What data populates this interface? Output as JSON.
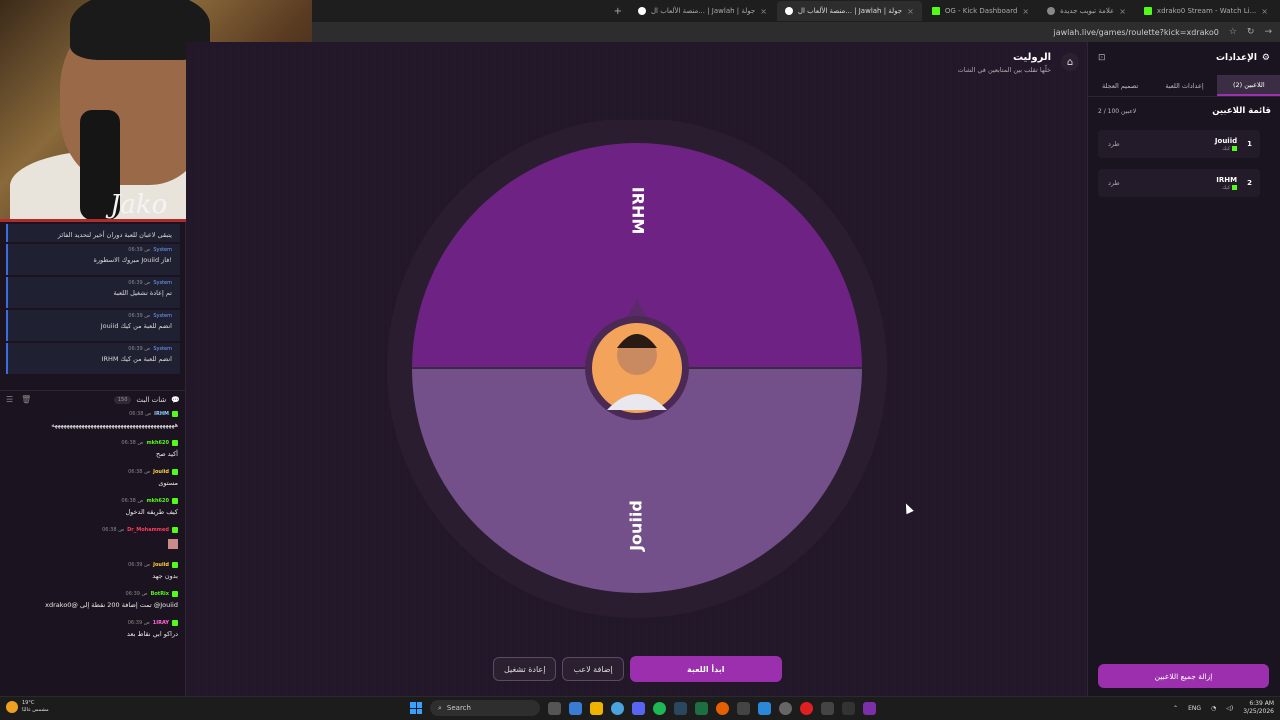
{
  "browser": {
    "tabs": [
      {
        "label": "xdrako0 Stream - Watch Li...",
        "icon": "kick"
      },
      {
        "label": "علامة تبويب جديدة",
        "icon": "chrome"
      },
      {
        "label": "OG - Kick Dashboard",
        "icon": "kick"
      },
      {
        "label": "منصة الألعاب ال... | Jawlah | جولة",
        "icon": "jawlah",
        "active": true
      },
      {
        "label": "منصة الألعاب ال... | Jawlah | جولة",
        "icon": "jawlah"
      }
    ],
    "url": "jawlah.live/games/roulette?kick=xdrako0"
  },
  "webcam": {
    "overlay_text": "Jako"
  },
  "left_chat": {
    "system_messages": [
      {
        "text": "يتبقى لاعبان للعبة دوران أخير لتحديد الفائز",
        "user": "",
        "time": ""
      },
      {
        "user": "System",
        "time": "06:39 ص",
        "text": "مبروك الاسطورة Jouiid فاز!"
      },
      {
        "user": "System",
        "time": "06:39 ص",
        "text": "تم إعادة تشغيل اللعبة"
      },
      {
        "user": "System",
        "time": "06:39 ص",
        "text": "Jouiid انضم للعبة من كيك"
      },
      {
        "user": "System",
        "time": "06:39 ص",
        "text": "IRHM انضم للعبة من كيك"
      }
    ],
    "chat_title": "شات البث",
    "chat_count": "150",
    "messages": [
      {
        "user": "IRHM",
        "time": "06:38 ص",
        "color": "#8fd0ff",
        "text": "هههههههههههههههههههههههههههههههههههههههههه"
      },
      {
        "user": "mkh620",
        "time": "06:38 ص",
        "color": "#53fc18",
        "text": "أكيد صح"
      },
      {
        "user": "Jouiid",
        "time": "06:38 ص",
        "color": "#ffd040",
        "text": "مستوى"
      },
      {
        "user": "mkh620",
        "time": "06:38 ص",
        "color": "#53fc18",
        "text": "كيف طريقه الدخول"
      },
      {
        "user": "Dr_Mohammed",
        "time": "06:38 ص",
        "color": "#ff3b5c",
        "text": "",
        "emote": true
      },
      {
        "user": "Jouiid",
        "time": "06:39 ص",
        "color": "#ffd040",
        "text": "بدون جهد"
      },
      {
        "user": "BotRix",
        "time": "06:39 ص",
        "color": "#53fc18",
        "text": "xdrako0@ تمت إضافة 200 نقطة إلى @Jouiid"
      },
      {
        "user": "1IRAY",
        "time": "06:39 ص",
        "color": "#ff6ad5",
        "text": "دراكو ابي نقاط بعد"
      }
    ]
  },
  "main": {
    "title": "الروليت",
    "subtitle": "خلّها تقلب بين المتابعين في الشات",
    "wheel": {
      "segments": [
        {
          "label": "IRHM",
          "color": "#6e2283"
        },
        {
          "label": "Jouiid",
          "color": "#74508a"
        }
      ]
    },
    "buttons": {
      "start": "ابدأ اللعبة",
      "add_player": "إضافة لاعب",
      "restart": "إعادة تشغيل"
    }
  },
  "settings": {
    "title": "الإعدادات",
    "tabs": [
      "اللاعبين (2)",
      "إعدادات اللعبة",
      "تصميم العجلة"
    ],
    "list_title": "قائمة اللاعبين",
    "count": "2 / 100 لاعبين",
    "players": [
      {
        "num": "1",
        "name": "Jouiid",
        "source": "كيك",
        "kick_label": "طرد"
      },
      {
        "num": "2",
        "name": "IRHM",
        "source": "كيك",
        "kick_label": "طرد"
      }
    ],
    "remove_all": "إزالة جميع اللاعبين"
  },
  "taskbar": {
    "weather_temp": "19°C",
    "weather_desc": "مشمس غالبًا",
    "search": "Search",
    "lang": "ENG",
    "time": "6:39 AM",
    "date": "3/25/2026"
  }
}
